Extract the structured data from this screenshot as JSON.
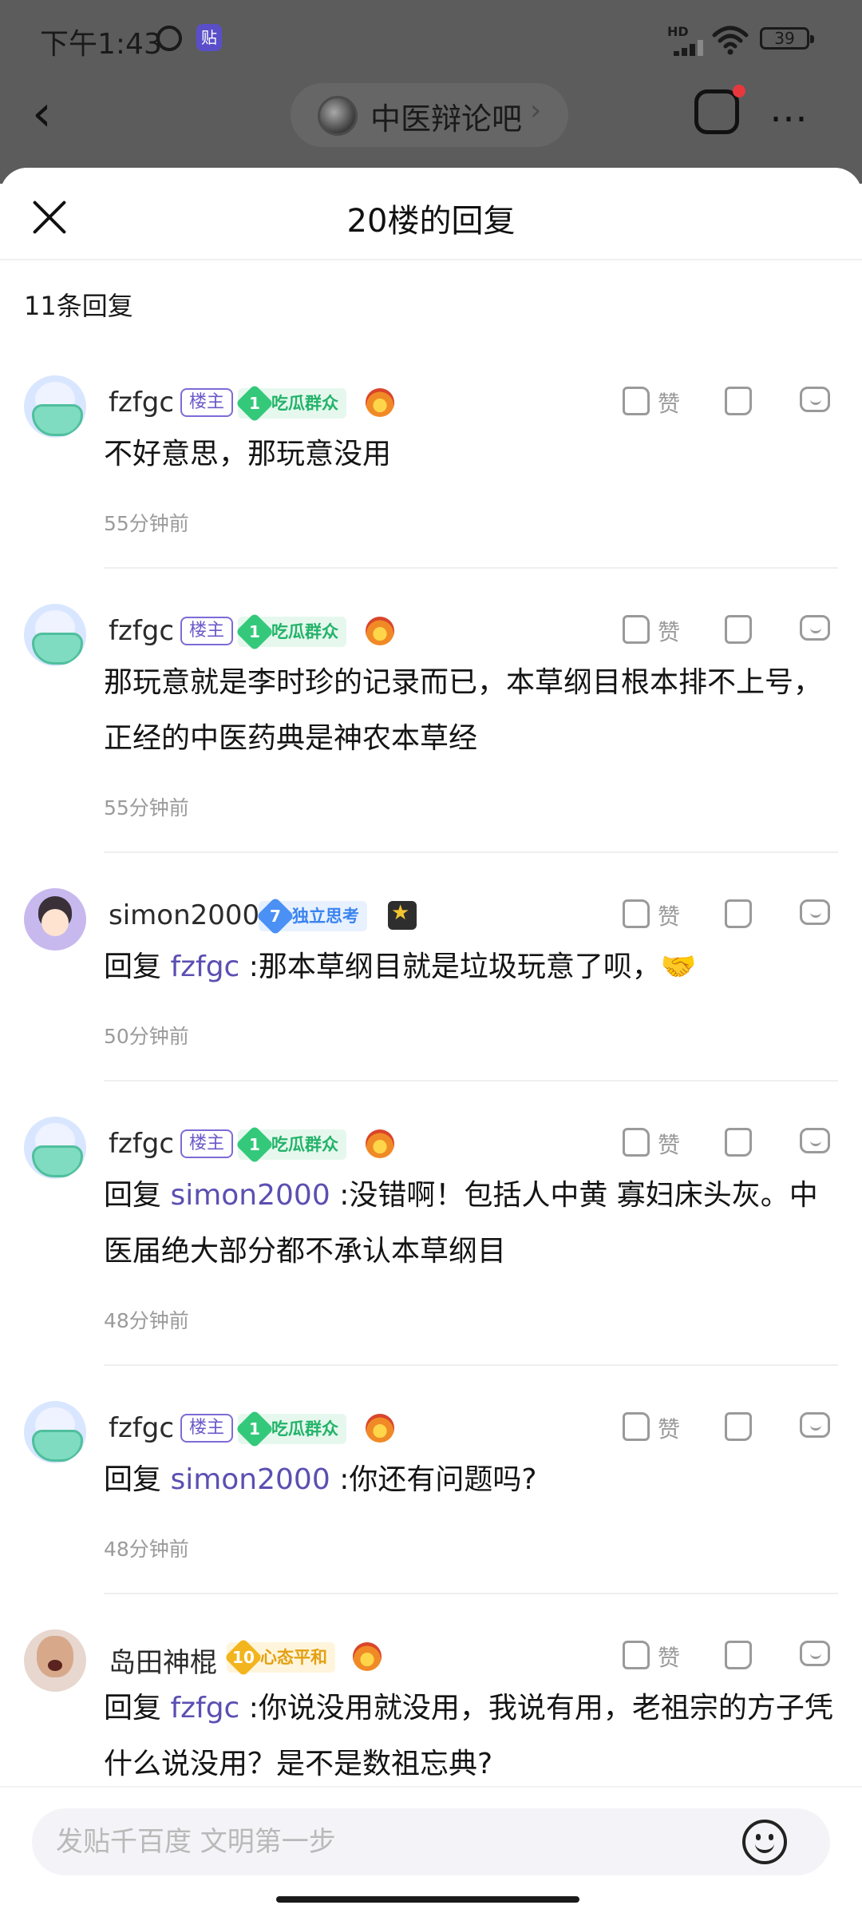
{
  "status_bar": {
    "time": "下午1:43",
    "network": "HD",
    "battery": "39",
    "icons": [
      "alarm-icon",
      "app-notification-icon",
      "signal-icon",
      "wifi-icon",
      "battery-icon"
    ]
  },
  "nav": {
    "forum_name": "中医辩论吧",
    "forum_arrow": "›",
    "back_icon": "chevron-left-icon",
    "more": "⋯"
  },
  "sheet": {
    "title": "20楼的回复",
    "reply_count": "11条回复"
  },
  "comments": [
    {
      "username": "fzfgc",
      "host_badge": "楼主",
      "level": "1",
      "level_title": "吃瓜群众",
      "like_label": "赞",
      "segments": [
        {
          "text": "不好意思，那玩意没用"
        }
      ],
      "time": "55分钟前"
    },
    {
      "username": "fzfgc",
      "host_badge": "楼主",
      "level": "1",
      "level_title": "吃瓜群众",
      "like_label": "赞",
      "segments": [
        {
          "text": "那玩意就是李时珍的记录而已，本草纲目根本排不上号，正经的中医药典是神农本草经"
        }
      ],
      "time": "55分钟前"
    },
    {
      "username": "simon2000",
      "level": "7",
      "level_title": "独立思考",
      "like_label": "赞",
      "segments": [
        {
          "text": "回复 "
        },
        {
          "text": "fzfgc",
          "mention": true
        },
        {
          "text": " :那本草纲目就是垃圾玩意了呗，🤝"
        }
      ],
      "time": "50分钟前"
    },
    {
      "username": "fzfgc",
      "host_badge": "楼主",
      "level": "1",
      "level_title": "吃瓜群众",
      "like_label": "赞",
      "segments": [
        {
          "text": "回复 "
        },
        {
          "text": "simon2000",
          "mention": true
        },
        {
          "text": " :没错啊！包括人中黄 寡妇床头灰。中医届绝大部分都不承认本草纲目"
        }
      ],
      "time": "48分钟前"
    },
    {
      "username": "fzfgc",
      "host_badge": "楼主",
      "level": "1",
      "level_title": "吃瓜群众",
      "like_label": "赞",
      "segments": [
        {
          "text": "回复 "
        },
        {
          "text": "simon2000",
          "mention": true
        },
        {
          "text": " :你还有问题吗?"
        }
      ],
      "time": "48分钟前"
    },
    {
      "username": "岛田神棍",
      "level": "10",
      "level_title": "心态平和",
      "like_label": "赞",
      "segments": [
        {
          "text": "回复 "
        },
        {
          "text": "fzfgc",
          "mention": true
        },
        {
          "text": " :你说没用就没用，我说有用，老祖宗的方子凭什么说没用？是不是数祖忘典?"
        }
      ],
      "time": ""
    }
  ],
  "input": {
    "placeholder": "发贴千百度 文明第一步"
  },
  "colors": {
    "mention": "#5b4fb2",
    "host_badge": "#7d6bd6",
    "level_green": "#34c97a",
    "level_blue": "#4a90f5",
    "level_orange": "#f2b51d",
    "notification_dot": "#e8383d"
  }
}
